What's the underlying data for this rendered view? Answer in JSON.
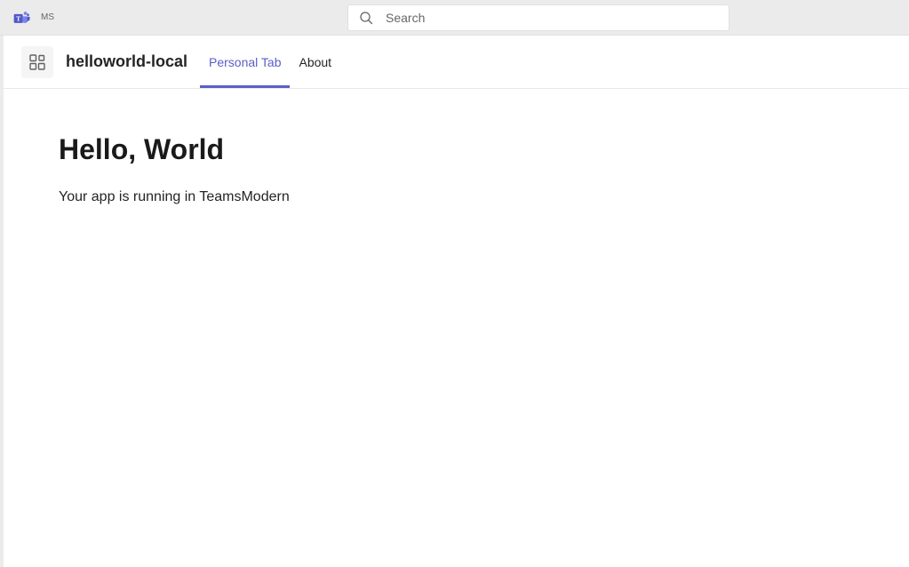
{
  "header": {
    "user_initials": "MS",
    "search_placeholder": "Search"
  },
  "app": {
    "title": "helloworld-local",
    "tabs": [
      {
        "label": "Personal Tab",
        "active": true
      },
      {
        "label": "About",
        "active": false
      }
    ]
  },
  "content": {
    "heading": "Hello, World",
    "body": "Your app is running in TeamsModern"
  },
  "colors": {
    "accent": "#5b5fc7",
    "top_bar_bg": "#ebebeb"
  }
}
